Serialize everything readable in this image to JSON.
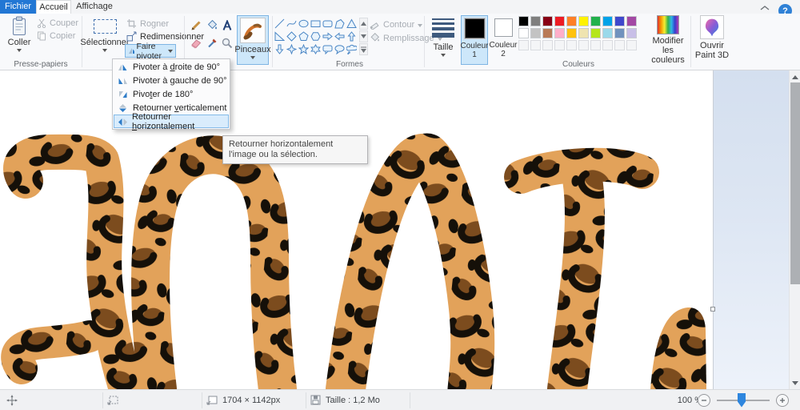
{
  "tabs": {
    "fichier": "Fichier",
    "accueil": "Accueil",
    "affichage": "Affichage"
  },
  "window": {
    "help": "?"
  },
  "ribbon": {
    "clipboard": {
      "group": "Presse-papiers",
      "coller": "Coller",
      "couper": "Couper",
      "copier": "Copier"
    },
    "image": {
      "selectionner": "Sélectionner",
      "rogner": "Rogner",
      "redimensionner": "Redimensionner",
      "faire_pivoter": "Faire pivoter"
    },
    "brushes": {
      "pinceaux": "Pinceaux"
    },
    "shapes": {
      "group": "Formes",
      "contour": "Contour",
      "remplissage": "Remplissage",
      "items": [
        "line",
        "curve",
        "oval",
        "rectangle",
        "rounded-rectangle",
        "polygon",
        "triangle",
        "right-triangle",
        "diamond",
        "pentagon",
        "hexagon",
        "arrow-right",
        "arrow-left",
        "arrow-up",
        "arrow-down",
        "star-4",
        "star-5",
        "star-6",
        "callout-rounded",
        "callout-oval",
        "callout-cloud"
      ]
    },
    "size": {
      "taille": "Taille"
    },
    "colors": {
      "group": "Couleurs",
      "color1_label": "Couleur",
      "color1_num": "1",
      "color1_value": "#000000",
      "color2_label": "Couleur",
      "color2_num": "2",
      "color2_value": "#ffffff",
      "palette_row1": [
        "#000000",
        "#7f7f7f",
        "#880015",
        "#ed1c24",
        "#ff7f27",
        "#fff200",
        "#22b14c",
        "#00a2e8",
        "#3f48cc",
        "#a349a4"
      ],
      "palette_row2": [
        "#ffffff",
        "#c3c3c3",
        "#b97a57",
        "#ffaec9",
        "#ffc20e",
        "#efe4b0",
        "#b5e61d",
        "#99d9ea",
        "#7092be",
        "#c8bfe7"
      ],
      "modifier": "Modifier les couleurs",
      "paint3d": "Ouvrir Paint 3D"
    }
  },
  "menu": {
    "items": [
      {
        "pre": "Pivoter à ",
        "u": "d",
        "post": "roite de 90°"
      },
      {
        "pre": "Pivoter à ",
        "u": "g",
        "post": "auche de 90°"
      },
      {
        "pre": "Pivo",
        "u": "t",
        "post": "er de 180°"
      },
      {
        "pre": "Retourner ",
        "u": "v",
        "post": "erticalement"
      },
      {
        "pre": "Retourner ",
        "u": "h",
        "post": "orizontalement"
      }
    ]
  },
  "tooltip": {
    "text": "Retourner horizontalement l'image ou la sélection."
  },
  "statusbar": {
    "dimensions": "1704 × 1142px",
    "file_size": "Taille : 1,2 Mo",
    "zoom": "100 %"
  },
  "canvas": {
    "text": "JADE",
    "mirrored": true,
    "pattern_colors": {
      "base": "#e2a25a",
      "brown": "#7c4c1e",
      "black": "#151009"
    }
  }
}
